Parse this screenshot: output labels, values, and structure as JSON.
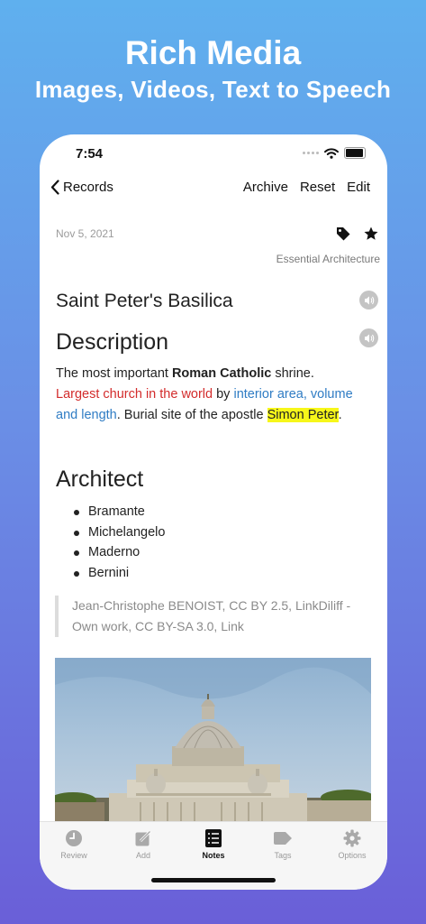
{
  "promo": {
    "title": "Rich Media",
    "subtitle": "Images, Videos, Text to Speech"
  },
  "status": {
    "time": "7:54"
  },
  "nav": {
    "back_label": "Records",
    "archive_label": "Archive",
    "reset_label": "Reset",
    "edit_label": "Edit"
  },
  "note": {
    "date": "Nov 5, 2021",
    "category": "Essential Architecture",
    "title": "Saint Peter's Basilica",
    "description_heading": "Description",
    "desc": {
      "t1": "The most important ",
      "bold": "Roman Catholic",
      "t2": " shrine.",
      "red": "Largest church in the world",
      "t3": " by ",
      "blue": "interior area, volume and length",
      "t4": ". Burial site of the apostle ",
      "highlight": "Simon Peter",
      "t5": "."
    },
    "architect_heading": "Architect",
    "architects": [
      "Bramante",
      "Michelangelo",
      "Maderno",
      "Bernini"
    ],
    "credit": "Jean-Christophe BENOIST, CC BY 2.5, LinkDiliff - Own work, CC BY-SA 3.0, Link"
  },
  "tabs": [
    {
      "label": "Review",
      "icon": "clock-icon"
    },
    {
      "label": "Add",
      "icon": "compose-icon"
    },
    {
      "label": "Notes",
      "icon": "list-icon"
    },
    {
      "label": "Tags",
      "icon": "tag-icon"
    },
    {
      "label": "Options",
      "icon": "gear-icon"
    }
  ],
  "active_tab": "Notes",
  "colors": {
    "accent_red": "#d32c2c",
    "accent_blue": "#2f7cc4",
    "highlight": "#f7f71a"
  }
}
